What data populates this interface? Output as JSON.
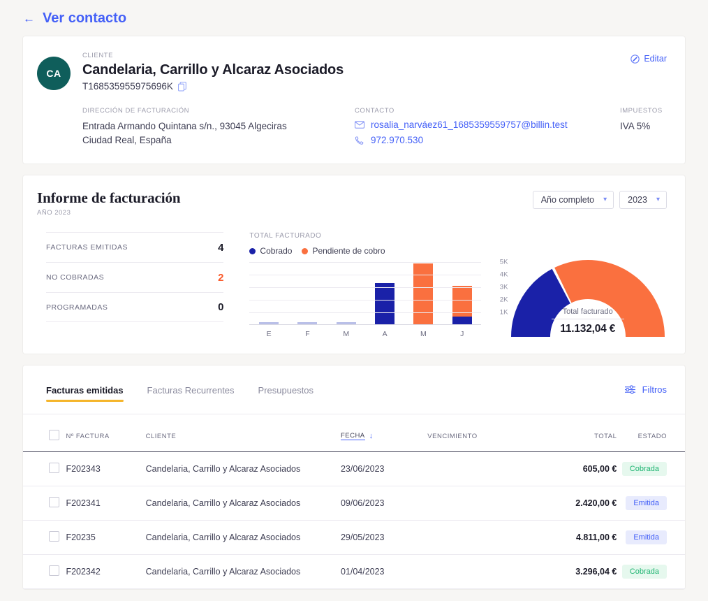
{
  "topbar": {
    "back_label": "Ver contacto",
    "back_icon": "arrow-left-icon"
  },
  "client": {
    "avatar_initials": "CA",
    "avatar_color": "#0f5e5b",
    "label_cliente": "CLIENTE",
    "name": "Candelaria, Carrillo y Alcaraz Asociados",
    "nif": "T168535955975696K",
    "copy_icon": "copy-icon",
    "edit_label": "Editar",
    "edit_icon": "pencil-circle-icon",
    "billing": {
      "label": "DIRECCIÓN DE FACTURACIÓN",
      "line1": "Entrada Armando Quintana s/n., 93045 Algeciras",
      "line2": "Ciudad Real, España"
    },
    "contact": {
      "label": "CONTACTO",
      "email": "rosalia_narváez61_1685359559757@billin.test",
      "email_icon": "envelope-icon",
      "phone": "972.970.530",
      "phone_icon": "phone-icon"
    },
    "taxes": {
      "label": "IMPUESTOS",
      "value": "IVA 5%"
    }
  },
  "report": {
    "title": "Informe de facturación",
    "subtitle": "AÑO 2023",
    "period_select": {
      "value": "Año completo",
      "chevron": "chevron-down-icon"
    },
    "year_select": {
      "value": "2023",
      "chevron": "chevron-down-icon"
    },
    "stats": [
      {
        "label": "FACTURAS EMITIDAS",
        "value": "4",
        "alert": false
      },
      {
        "label": "NO COBRADAS",
        "value": "2",
        "alert": true
      },
      {
        "label": "PROGRAMADAS",
        "value": "0",
        "alert": false
      }
    ],
    "gauge": {
      "caption": "Total facturado",
      "total": "11.132,04 €",
      "paid_color": "#1a21a8",
      "pending_color": "#fa703f",
      "paid_fraction": 0.351,
      "pending_fraction": 0.649
    }
  },
  "chart_data": {
    "type": "bar",
    "title": "TOTAL FACTURADO",
    "stacked": true,
    "categories": [
      "E",
      "F",
      "M",
      "A",
      "M",
      "J"
    ],
    "series": [
      {
        "name": "Cobrado",
        "color": "#1a21a8",
        "values": [
          0,
          0,
          0,
          3296.04,
          0,
          605
        ]
      },
      {
        "name": "Pendiente de cobro",
        "color": "#fa703f",
        "values": [
          0,
          0,
          0,
          0,
          4811,
          2420
        ]
      }
    ],
    "legend": [
      "Cobrado",
      "Pendiente de cobro"
    ],
    "legend_position": "top-left",
    "ylim": [
      0,
      5000
    ],
    "yticks": [
      "1K",
      "2K",
      "3K",
      "4K",
      "5K"
    ],
    "ytick_values": [
      1000,
      2000,
      3000,
      4000,
      5000
    ],
    "xlabel": "",
    "ylabel": "",
    "grid": true
  },
  "invoices": {
    "tabs": [
      {
        "label": "Facturas emitidas",
        "active": true
      },
      {
        "label": "Facturas Recurrentes",
        "active": false
      },
      {
        "label": "Presupuestos",
        "active": false
      }
    ],
    "filters_label": "Filtros",
    "filters_icon": "sliders-icon",
    "columns": {
      "num": "Nº FACTURA",
      "cliente": "CLIENTE",
      "fecha": "FECHA",
      "vencimiento": "VENCIMIENTO",
      "total": "TOTAL",
      "estado": "ESTADO",
      "sort_icon": "arrow-down-icon"
    },
    "rows": [
      {
        "num": "F202343",
        "cliente": "Candelaria, Carrillo y Alcaraz Asociados",
        "fecha": "23/06/2023",
        "vencimiento": "",
        "total": "605,00 €",
        "estado": "Cobrada",
        "estado_kind": "cobrada"
      },
      {
        "num": "F202341",
        "cliente": "Candelaria, Carrillo y Alcaraz Asociados",
        "fecha": "09/06/2023",
        "vencimiento": "",
        "total": "2.420,00 €",
        "estado": "Emitida",
        "estado_kind": "emitida"
      },
      {
        "num": "F20235",
        "cliente": "Candelaria, Carrillo y Alcaraz Asociados",
        "fecha": "29/05/2023",
        "vencimiento": "",
        "total": "4.811,00 €",
        "estado": "Emitida",
        "estado_kind": "emitida"
      },
      {
        "num": "F202342",
        "cliente": "Candelaria, Carrillo y Alcaraz Asociados",
        "fecha": "01/04/2023",
        "vencimiento": "",
        "total": "3.296,04 €",
        "estado": "Cobrada",
        "estado_kind": "cobrada"
      }
    ]
  }
}
